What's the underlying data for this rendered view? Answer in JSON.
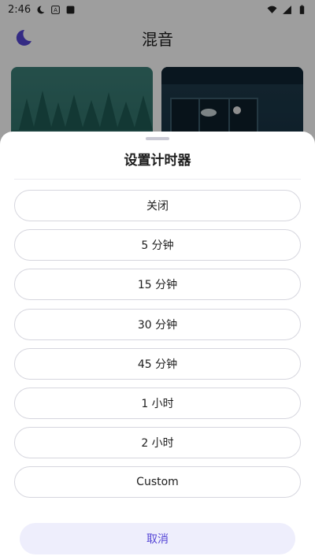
{
  "status_bar": {
    "time": "2:46",
    "icons_left": [
      "moon-icon",
      "text-icon",
      "app-icon"
    ],
    "icons_right": [
      "wifi-icon",
      "signal-icon",
      "battery-icon"
    ]
  },
  "app": {
    "title": "混音",
    "cards": [
      "forest-scene",
      "room-scene"
    ]
  },
  "sheet": {
    "title": "设置计时器",
    "options": [
      {
        "label": "关闭"
      },
      {
        "label": "5 分钟"
      },
      {
        "label": "15 分钟"
      },
      {
        "label": "30 分钟"
      },
      {
        "label": "45 分钟"
      },
      {
        "label": "1 小时"
      },
      {
        "label": "2 小时"
      },
      {
        "label": "Custom"
      }
    ],
    "cancel_label": "取消"
  },
  "colors": {
    "accent": "#5546d6",
    "cancel_bg": "#eeeefc"
  }
}
